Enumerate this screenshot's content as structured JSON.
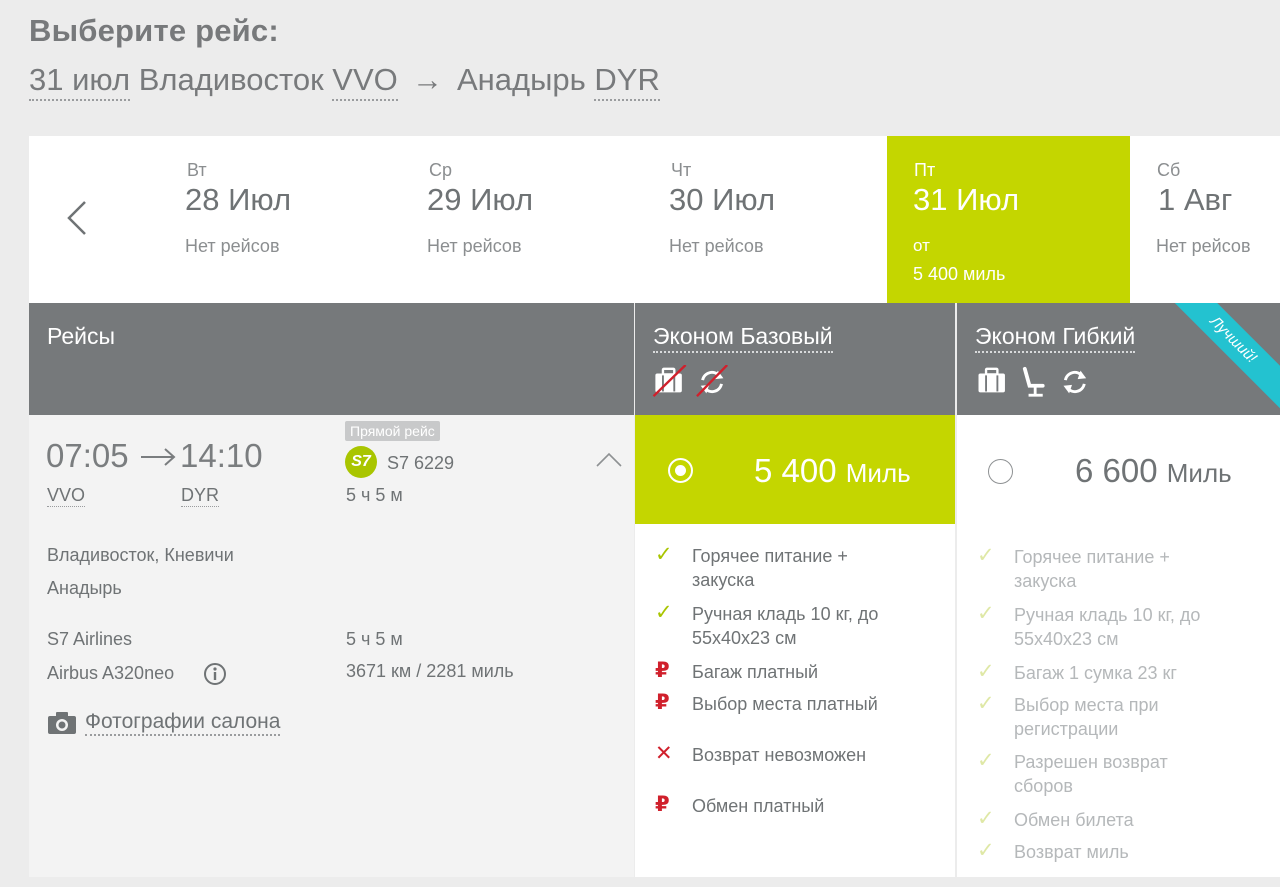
{
  "header": {
    "title": "Выберите рейс:",
    "route": {
      "date": "31 июл",
      "from_city": "Владивосток",
      "from_code": "VVO",
      "arrow": "→",
      "to_city": "Анадырь",
      "to_code": "DYR"
    }
  },
  "dates": [
    {
      "weekday": "Вт",
      "date": "28 Июл",
      "status": "Нет рейсов"
    },
    {
      "weekday": "Ср",
      "date": "29 Июл",
      "status": "Нет рейсов"
    },
    {
      "weekday": "Чт",
      "date": "30 Июл",
      "status": "Нет рейсов"
    },
    {
      "weekday": "Пт",
      "date": "31 Июл",
      "status": "от",
      "price": "5 400 миль",
      "active": true
    },
    {
      "weekday": "Сб",
      "date": "1 Авг",
      "status": "Нет рейсов"
    }
  ],
  "columns": {
    "flights": "Рейсы",
    "basic": "Эконом Базовый",
    "flex": "Эконом Гибкий",
    "flex_ribbon": "Лучший!"
  },
  "flight": {
    "depart_time": "07:05",
    "arrive_time": "14:10",
    "depart_code": "VVO",
    "arrive_code": "DYR",
    "badge": "Прямой рейс",
    "airline_logo": "S7",
    "flight_number": "S7 6229",
    "duration": "5 ч 5 м",
    "depart_airport": "Владивосток, Кневичи",
    "arrive_airport": "Анадырь",
    "airline": "S7 Airlines",
    "aircraft": "Airbus A320neo",
    "duration_detail": "5 ч 5 м",
    "distance": "3671 км / 2281 миль",
    "photos_link": "Фотографии салона"
  },
  "fares": {
    "basic": {
      "price": "5 400",
      "unit": "Миль",
      "features": [
        {
          "icon": "check",
          "line1": "Горячее питание +",
          "line2": "закуска"
        },
        {
          "icon": "check",
          "line1": "Ручная кладь 10 кг, до",
          "line2": "55х40х23 см"
        },
        {
          "icon": "rub",
          "line1": "Багаж платный"
        },
        {
          "icon": "rub",
          "line1": "Выбор места платный"
        },
        {
          "icon": "cross",
          "line1": "Возврат невозможен"
        },
        {
          "icon": "rub",
          "line1": "Обмен платный"
        }
      ]
    },
    "flex": {
      "price": "6 600",
      "unit": "Миль",
      "features": [
        {
          "icon": "check",
          "line1": "Горячее питание +",
          "line2": "закуска"
        },
        {
          "icon": "check",
          "line1": "Ручная кладь 10 кг, до",
          "line2": "55х40х23 см"
        },
        {
          "icon": "check",
          "line1": "Багаж 1 сумка 23 кг"
        },
        {
          "icon": "check",
          "line1": "Выбор места при",
          "line2": "регистрации"
        },
        {
          "icon": "check",
          "line1": "Разрешен возврат",
          "line2": "сборов"
        },
        {
          "icon": "check",
          "line1": "Обмен билета"
        },
        {
          "icon": "check",
          "line1": "Возврат миль"
        }
      ]
    }
  },
  "icons": {
    "check": "✓",
    "rub": "₽",
    "cross": "✕"
  },
  "colors": {
    "accent": "#c4d600",
    "header_bg": "#76797b",
    "ribbon": "#23c2d0",
    "danger": "#d0202c"
  }
}
